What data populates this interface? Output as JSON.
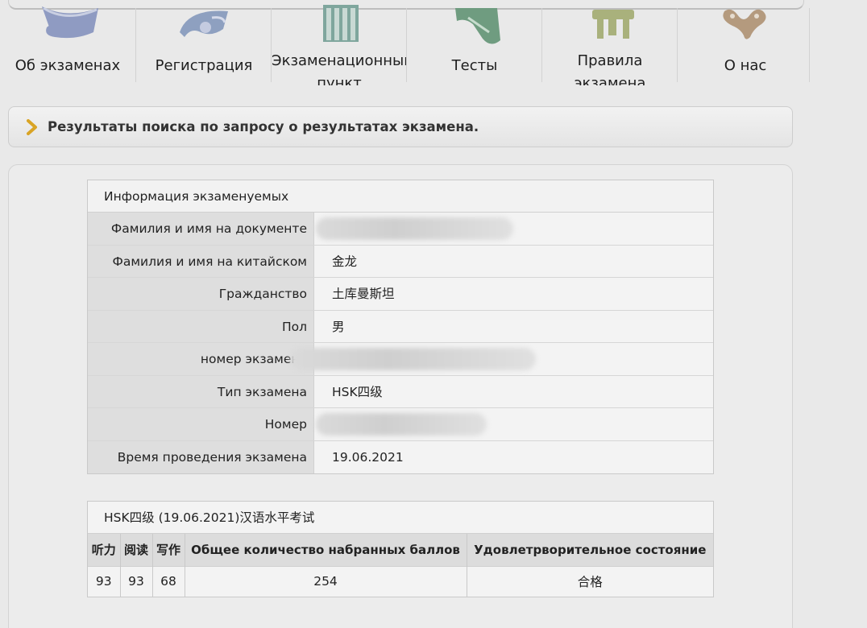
{
  "nav": {
    "items": [
      {
        "label": "Об экзаменах",
        "icon": "scroll-icon"
      },
      {
        "label": "Регистрация",
        "icon": "fan-icon"
      },
      {
        "label": "Экзаменационный пункт",
        "icon": "building-icon"
      },
      {
        "label": "Тесты",
        "icon": "book-icon"
      },
      {
        "label": "Правила экзамена",
        "icon": "table-icon"
      },
      {
        "label": "О нас",
        "icon": "ornament-icon"
      }
    ]
  },
  "title_bar": {
    "text": "Результаты поиска по запросу о результатах экзамена."
  },
  "info": {
    "heading": "Информация экзаменуемых",
    "rows": [
      {
        "label": "Фамилия и имя на документе",
        "value": ""
      },
      {
        "label": "Фамилия и имя на китайском",
        "value": "金龙"
      },
      {
        "label": "Гражданство",
        "value": "土库曼斯坦"
      },
      {
        "label": "Пол",
        "value": "男"
      },
      {
        "label": "номер экзамена",
        "value": ""
      },
      {
        "label": "Тип экзамена",
        "value": "HSK四级"
      },
      {
        "label": "Номер",
        "value": ""
      },
      {
        "label": "Время проведения экзамена",
        "value": "19.06.2021"
      }
    ]
  },
  "score": {
    "heading": "HSK四级 (19.06.2021)汉语水平考试",
    "columns": [
      "听力",
      "阅读",
      "写作",
      "Общее количество набранных баллов",
      "Удовлетрворительное состояние"
    ],
    "values": [
      "93",
      "93",
      "68",
      "254",
      "合格"
    ]
  },
  "colors": {
    "accent": "#d9a425",
    "nav_icon": "#9ea7c4"
  }
}
